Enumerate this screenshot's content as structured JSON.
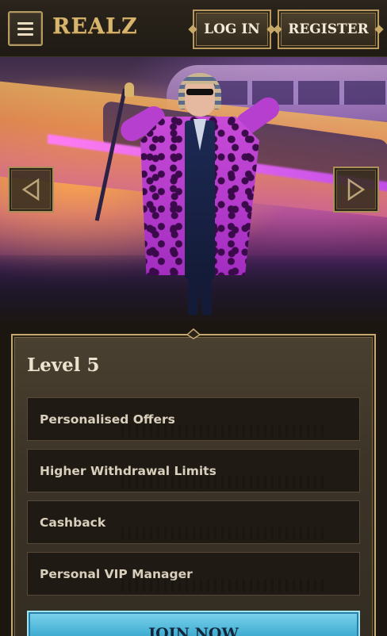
{
  "header": {
    "logo_text": "REALZ",
    "login_label": "LOG IN",
    "register_label": "REGISTER"
  },
  "hero": {
    "prev_icon": "triangle-left-icon",
    "next_icon": "triangle-right-icon"
  },
  "level": {
    "title": "Level 5",
    "benefits": [
      {
        "label": "Personalised Offers"
      },
      {
        "label": "Higher Withdrawal Limits"
      },
      {
        "label": "Cashback"
      },
      {
        "label": "Personal VIP Manager"
      }
    ],
    "join_label": "JOIN NOW"
  },
  "colors": {
    "gold_border": "#c5a86f",
    "dark_bg": "#1b160f",
    "join_blue": "#48b3d6"
  }
}
